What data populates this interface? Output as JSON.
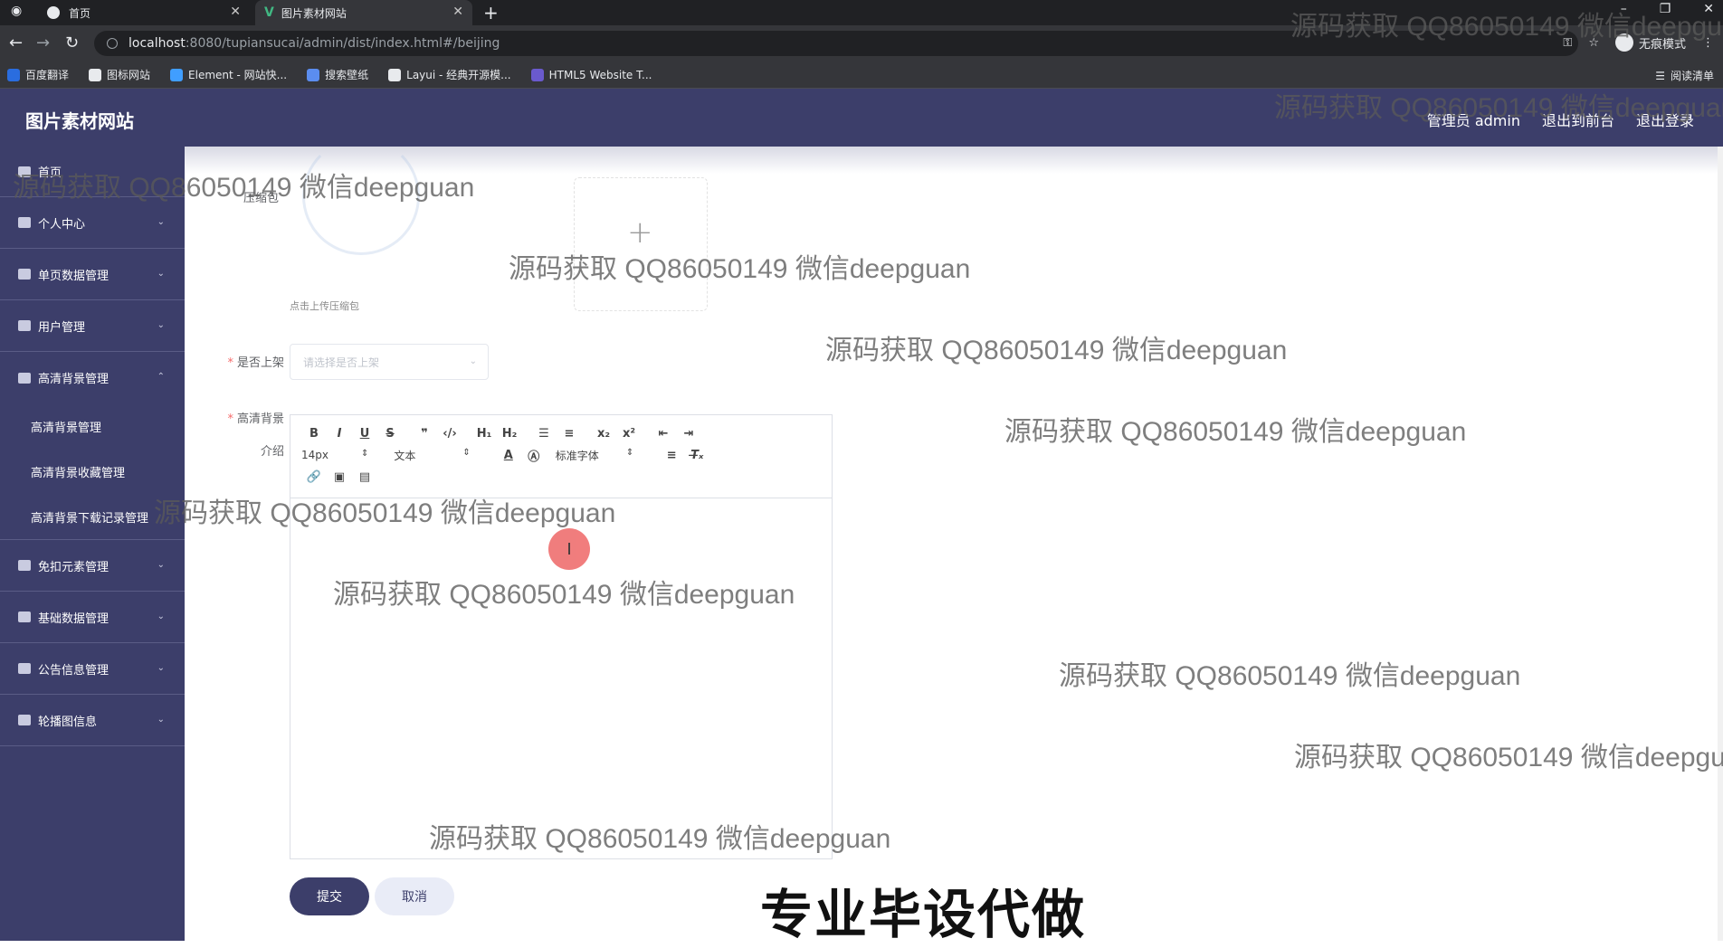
{
  "browser": {
    "tabs": [
      {
        "title": "首页"
      },
      {
        "title": "图片素材网站"
      }
    ],
    "url_host": "localhost",
    "url_path": ":8080/tupiansucai/admin/dist/index.html#/beijing",
    "incognito_label": "无痕模式",
    "reading_list_label": "阅读清单",
    "bookmarks": [
      {
        "label": "百度翻译",
        "color": "#2a6ddf"
      },
      {
        "label": "图标网站",
        "color": "#e8eaed"
      },
      {
        "label": "Element - 网站快...",
        "color": "#409eff"
      },
      {
        "label": "搜索壁纸",
        "color": "#5b8def"
      },
      {
        "label": "Layui - 经典开源模...",
        "color": "#e8eaed"
      },
      {
        "label": "HTML5 Website T...",
        "color": "#6a5acd"
      }
    ]
  },
  "app": {
    "brand": "图片素材网站",
    "header_links": [
      "管理员 admin",
      "退出到前台",
      "退出登录"
    ]
  },
  "sidebar": {
    "items": [
      {
        "label": "首页"
      },
      {
        "label": "个人中心"
      },
      {
        "label": "单页数据管理"
      },
      {
        "label": "用户管理"
      },
      {
        "label": "高清背景管理"
      },
      {
        "label": "免扣元素管理"
      },
      {
        "label": "基础数据管理"
      },
      {
        "label": "公告信息管理"
      },
      {
        "label": "轮播图信息"
      }
    ],
    "submenu": [
      "高清背景管理",
      "高清背景收藏管理",
      "高清背景下载记录管理"
    ]
  },
  "form": {
    "upload_label": "压缩包",
    "upload_tip": "点击上传压缩包",
    "shelf_label": "是否上架",
    "shelf_placeholder": "请选择是否上架",
    "intro_label_1": "高清背景",
    "intro_label_2": "介绍",
    "editor": {
      "font_size": "14px",
      "text_type": "文本",
      "font_family": "标准字体"
    },
    "submit_label": "提交",
    "cancel_label": "取消"
  },
  "overlay": {
    "watermark": "源码获取 QQ86050149 微信deepguan",
    "caption": "专业毕设代做"
  },
  "colors": {
    "theme": "#3c3e6a",
    "required": "#f56c6c",
    "cursor": "#ef6f6f"
  }
}
